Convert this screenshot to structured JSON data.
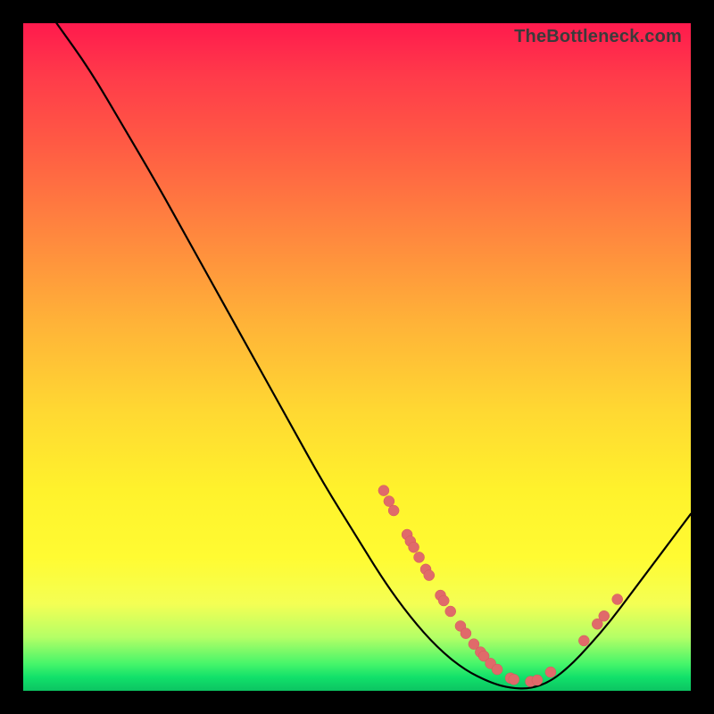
{
  "watermark": "TheBottleneck.com",
  "colors": {
    "dot_fill": "#e06a6a",
    "dot_stroke": "#d35a5a",
    "curve": "#000000"
  },
  "chart_data": {
    "type": "line",
    "title": "",
    "xlabel": "",
    "ylabel": "",
    "xlim": [
      0,
      100
    ],
    "ylim": [
      0,
      100
    ],
    "curve": [
      {
        "x": 5.0,
        "y": 100.0
      },
      {
        "x": 10.0,
        "y": 93.0
      },
      {
        "x": 15.0,
        "y": 84.5
      },
      {
        "x": 20.0,
        "y": 76.0
      },
      {
        "x": 25.0,
        "y": 67.0
      },
      {
        "x": 30.0,
        "y": 58.0
      },
      {
        "x": 35.0,
        "y": 49.0
      },
      {
        "x": 40.0,
        "y": 40.0
      },
      {
        "x": 45.0,
        "y": 31.0
      },
      {
        "x": 50.0,
        "y": 23.0
      },
      {
        "x": 54.0,
        "y": 16.5
      },
      {
        "x": 58.0,
        "y": 11.0
      },
      {
        "x": 62.0,
        "y": 6.5
      },
      {
        "x": 66.0,
        "y": 3.2
      },
      {
        "x": 70.0,
        "y": 1.2
      },
      {
        "x": 73.0,
        "y": 0.4
      },
      {
        "x": 76.0,
        "y": 0.3
      },
      {
        "x": 79.0,
        "y": 1.4
      },
      {
        "x": 82.0,
        "y": 3.8
      },
      {
        "x": 85.0,
        "y": 7.0
      },
      {
        "x": 88.0,
        "y": 10.5
      },
      {
        "x": 91.0,
        "y": 14.5
      },
      {
        "x": 94.0,
        "y": 18.5
      },
      {
        "x": 97.0,
        "y": 22.5
      },
      {
        "x": 100.0,
        "y": 26.5
      }
    ],
    "scatter": [
      {
        "x": 54.0,
        "y": 30.0
      },
      {
        "x": 54.8,
        "y": 28.4
      },
      {
        "x": 55.5,
        "y": 27.0
      },
      {
        "x": 57.5,
        "y": 23.4
      },
      {
        "x": 58.0,
        "y": 22.4
      },
      {
        "x": 58.5,
        "y": 21.5
      },
      {
        "x": 59.3,
        "y": 20.0
      },
      {
        "x": 60.3,
        "y": 18.2
      },
      {
        "x": 60.8,
        "y": 17.3
      },
      {
        "x": 62.5,
        "y": 14.3
      },
      {
        "x": 63.0,
        "y": 13.5
      },
      {
        "x": 64.0,
        "y": 11.9
      },
      {
        "x": 65.5,
        "y": 9.7
      },
      {
        "x": 66.3,
        "y": 8.6
      },
      {
        "x": 67.5,
        "y": 7.0
      },
      {
        "x": 68.5,
        "y": 5.8
      },
      {
        "x": 69.0,
        "y": 5.2
      },
      {
        "x": 70.0,
        "y": 4.1
      },
      {
        "x": 71.0,
        "y": 3.2
      },
      {
        "x": 73.0,
        "y": 1.9
      },
      {
        "x": 73.5,
        "y": 1.7
      },
      {
        "x": 76.0,
        "y": 1.4
      },
      {
        "x": 77.0,
        "y": 1.6
      },
      {
        "x": 79.0,
        "y": 2.8
      },
      {
        "x": 84.0,
        "y": 7.5
      },
      {
        "x": 86.0,
        "y": 10.0
      },
      {
        "x": 87.0,
        "y": 11.2
      },
      {
        "x": 89.0,
        "y": 13.7
      }
    ],
    "dot_radius": 6
  }
}
